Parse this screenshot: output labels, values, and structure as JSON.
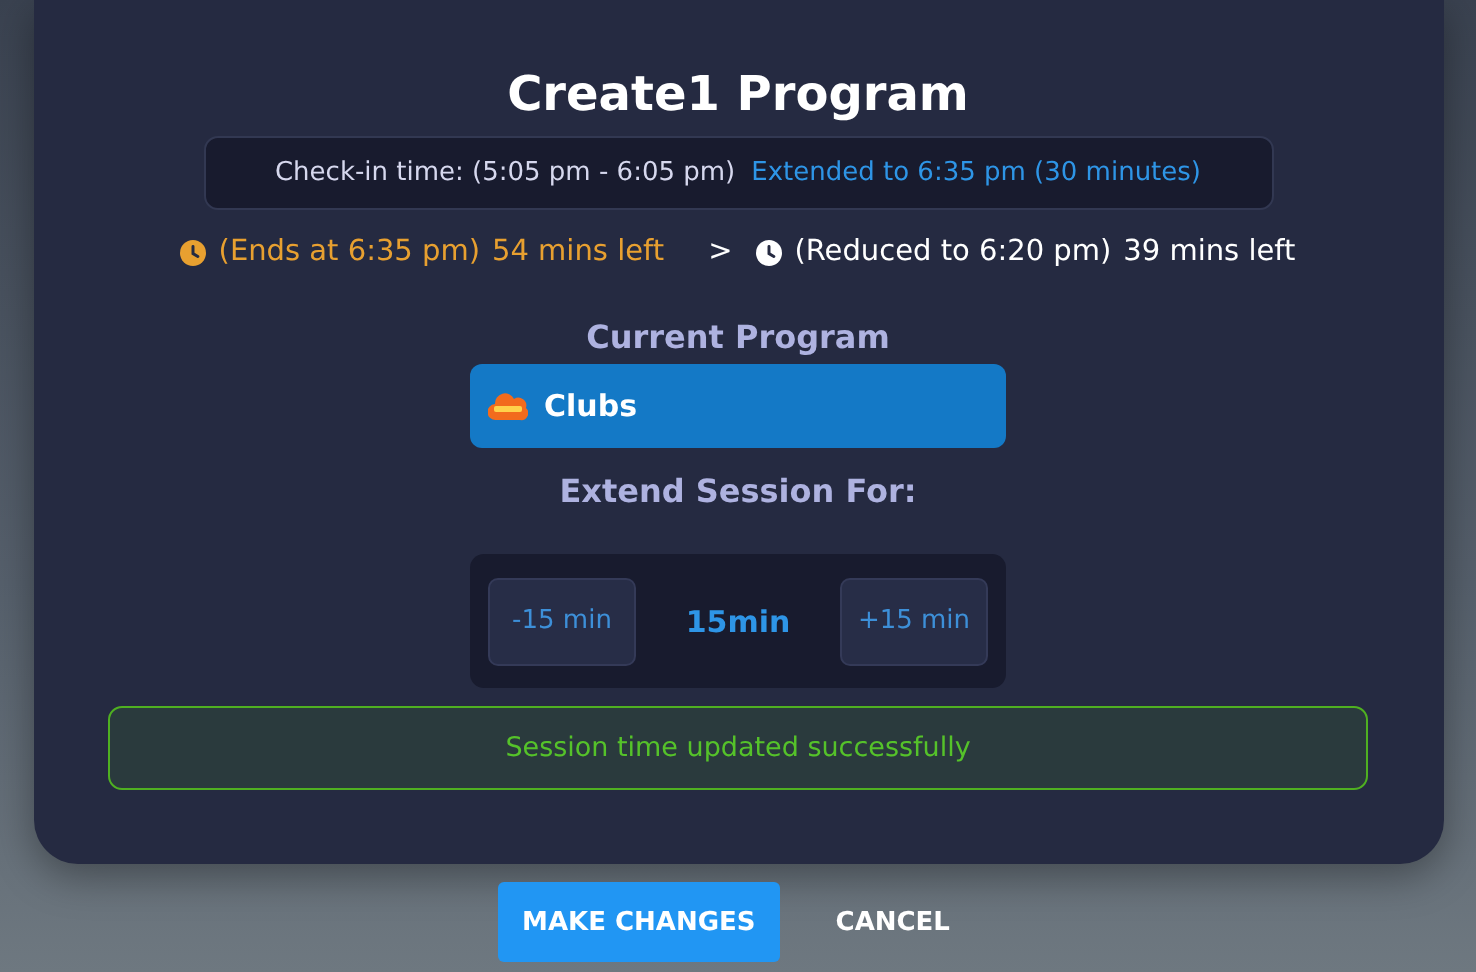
{
  "dialog": {
    "title": "Create1 Program",
    "checkin": {
      "label": "Check-in time: (5:05 pm - 6:05 pm)",
      "extended": "Extended to 6:35 pm (30 minutes)"
    },
    "times": [
      {
        "kind": "current",
        "ends": "(Ends at 6:35 pm)",
        "left": "54 mins left"
      },
      {
        "kind": "separator",
        "text": ">"
      },
      {
        "kind": "new",
        "ends": "(Reduced to 6:20 pm)",
        "left": "39 mins left"
      }
    ],
    "current_program": {
      "heading": "Current Program",
      "name": "Clubs"
    },
    "extend": {
      "heading": "Extend Session For:",
      "decrease": "-15 min",
      "value": "15min",
      "increase": "+15 min"
    },
    "message": "Session time updated successfully"
  },
  "buttons": [
    {
      "kind": "primary",
      "label": "MAKE CHANGES"
    },
    {
      "kind": "text",
      "label": "CANCEL"
    }
  ]
}
